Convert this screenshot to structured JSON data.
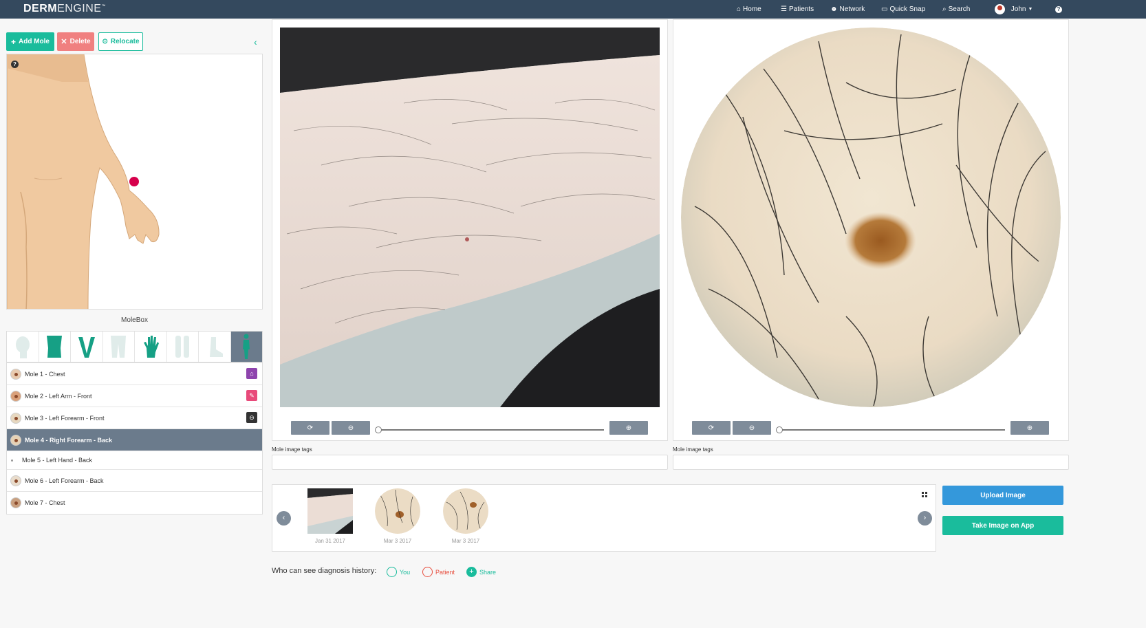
{
  "brand": {
    "bold": "DERM",
    "light": "ENGINE",
    "tm": "™"
  },
  "nav": {
    "home": "Home",
    "patients": "Patients",
    "network": "Network",
    "quick_snap": "Quick Snap",
    "search": "Search",
    "user": "John",
    "help": "?"
  },
  "toolbar": {
    "add_mole": "Add Mole",
    "delete": "Delete",
    "relocate": "Relocate"
  },
  "body_map": {
    "help": "?"
  },
  "molebox_label": "MoleBox",
  "body_parts": [
    "head-icon",
    "torso-icon",
    "arms-icon",
    "legs-icon",
    "hand-icon",
    "lower-legs-icon",
    "foot-icon",
    "full-body-icon"
  ],
  "moles": [
    {
      "label": "Mole 1 - Chest",
      "badge": "⌂",
      "badge_color": "#8e44ad"
    },
    {
      "label": "Mole 2 - Left Arm - Front",
      "badge": "✎",
      "badge_color": "#e84a7a"
    },
    {
      "label": "Mole 3 - Left Forearm - Front",
      "badge": "⊖",
      "badge_color": "#333333"
    },
    {
      "label": "Mole 4 - Right Forearm - Back",
      "badge": "",
      "badge_color": ""
    },
    {
      "label": "Mole 5 - Left Hand - Back",
      "badge": "",
      "badge_color": ""
    },
    {
      "label": "Mole 6 - Left Forearm - Back",
      "badge": "",
      "badge_color": ""
    },
    {
      "label": "Mole 7 - Chest",
      "badge": "",
      "badge_color": ""
    }
  ],
  "image_panels": {
    "tags_label": "Mole image tags",
    "controls": {
      "rotate": "⟳",
      "zoom_out": "⊖",
      "zoom_in": "⊕"
    }
  },
  "gallery": {
    "prev": "‹",
    "next": "›",
    "dates": [
      "Jan 31 2017",
      "Mar 3 2017",
      "Mar 3 2017"
    ]
  },
  "actions": {
    "upload": "Upload Image",
    "take_app": "Take Image on App"
  },
  "visibility": {
    "label": "Who can see diagnosis history:",
    "you": "You",
    "patient": "Patient",
    "share": "Share"
  },
  "colors": {
    "topbar": "#34495e",
    "accent": "#1abc9c",
    "danger": "#f08080",
    "primary": "#3498db",
    "selected": "#6b7b8c"
  }
}
